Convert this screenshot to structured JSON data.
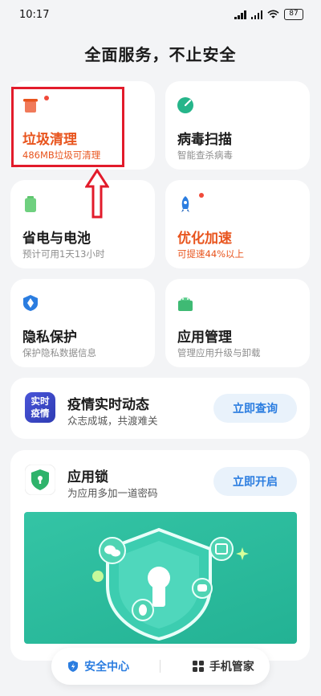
{
  "status_bar": {
    "time": "10:17",
    "battery": "87"
  },
  "page_title": "全面服务，不止安全",
  "tiles": {
    "junk": {
      "title": "垃圾清理",
      "subtitle": "486MB垃圾可清理",
      "icon": "trash-bin-icon"
    },
    "virus": {
      "title": "病毒扫描",
      "subtitle": "智能查杀病毒",
      "icon": "virus-scan-icon"
    },
    "battery": {
      "title": "省电与电池",
      "subtitle": "预计可用1天13小时",
      "icon": "battery-icon"
    },
    "boost": {
      "title": "优化加速",
      "subtitle": "可提速44%以上",
      "icon": "rocket-icon"
    },
    "privacy": {
      "title": "隐私保护",
      "subtitle": "保护隐私数据信息",
      "icon": "privacy-shield-icon"
    },
    "apps": {
      "title": "应用管理",
      "subtitle": "管理应用升级与卸载",
      "icon": "app-manager-icon"
    }
  },
  "epidemic": {
    "badge_line1": "实时",
    "badge_line2": "疫情",
    "title": "疫情实时动态",
    "subtitle": "众志成城，共渡难关",
    "button": "立即查询"
  },
  "app_lock": {
    "title": "应用锁",
    "subtitle": "为应用多加一道密码",
    "button": "立即开启"
  },
  "bottom_nav": {
    "security_center": "安全中心",
    "phone_manager": "手机管家"
  },
  "colors": {
    "accent_blue": "#2b7de0",
    "orange": "#e8541d",
    "annotation_red": "#e21b2b",
    "illustration_green": "#2bb99a"
  }
}
